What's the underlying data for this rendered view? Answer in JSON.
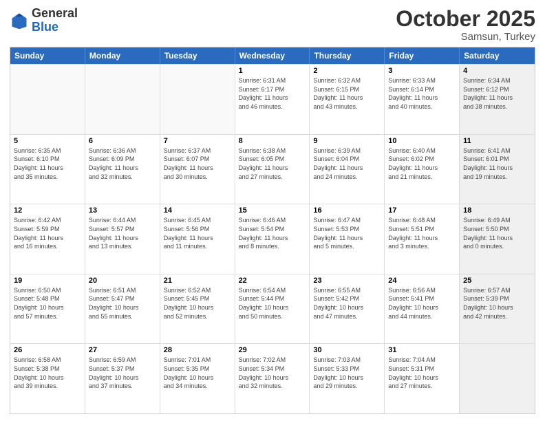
{
  "header": {
    "logo_general": "General",
    "logo_blue": "Blue",
    "month": "October 2025",
    "location": "Samsun, Turkey"
  },
  "days_of_week": [
    "Sunday",
    "Monday",
    "Tuesday",
    "Wednesday",
    "Thursday",
    "Friday",
    "Saturday"
  ],
  "weeks": [
    [
      {
        "day": "",
        "empty": true
      },
      {
        "day": "",
        "empty": true
      },
      {
        "day": "",
        "empty": true
      },
      {
        "day": "1",
        "lines": [
          "Sunrise: 6:31 AM",
          "Sunset: 6:17 PM",
          "Daylight: 11 hours",
          "and 46 minutes."
        ]
      },
      {
        "day": "2",
        "lines": [
          "Sunrise: 6:32 AM",
          "Sunset: 6:15 PM",
          "Daylight: 11 hours",
          "and 43 minutes."
        ]
      },
      {
        "day": "3",
        "lines": [
          "Sunrise: 6:33 AM",
          "Sunset: 6:14 PM",
          "Daylight: 11 hours",
          "and 40 minutes."
        ]
      },
      {
        "day": "4",
        "lines": [
          "Sunrise: 6:34 AM",
          "Sunset: 6:12 PM",
          "Daylight: 11 hours",
          "and 38 minutes."
        ],
        "shaded": true
      }
    ],
    [
      {
        "day": "5",
        "lines": [
          "Sunrise: 6:35 AM",
          "Sunset: 6:10 PM",
          "Daylight: 11 hours",
          "and 35 minutes."
        ]
      },
      {
        "day": "6",
        "lines": [
          "Sunrise: 6:36 AM",
          "Sunset: 6:09 PM",
          "Daylight: 11 hours",
          "and 32 minutes."
        ]
      },
      {
        "day": "7",
        "lines": [
          "Sunrise: 6:37 AM",
          "Sunset: 6:07 PM",
          "Daylight: 11 hours",
          "and 30 minutes."
        ]
      },
      {
        "day": "8",
        "lines": [
          "Sunrise: 6:38 AM",
          "Sunset: 6:05 PM",
          "Daylight: 11 hours",
          "and 27 minutes."
        ]
      },
      {
        "day": "9",
        "lines": [
          "Sunrise: 6:39 AM",
          "Sunset: 6:04 PM",
          "Daylight: 11 hours",
          "and 24 minutes."
        ]
      },
      {
        "day": "10",
        "lines": [
          "Sunrise: 6:40 AM",
          "Sunset: 6:02 PM",
          "Daylight: 11 hours",
          "and 21 minutes."
        ]
      },
      {
        "day": "11",
        "lines": [
          "Sunrise: 6:41 AM",
          "Sunset: 6:01 PM",
          "Daylight: 11 hours",
          "and 19 minutes."
        ],
        "shaded": true
      }
    ],
    [
      {
        "day": "12",
        "lines": [
          "Sunrise: 6:42 AM",
          "Sunset: 5:59 PM",
          "Daylight: 11 hours",
          "and 16 minutes."
        ]
      },
      {
        "day": "13",
        "lines": [
          "Sunrise: 6:44 AM",
          "Sunset: 5:57 PM",
          "Daylight: 11 hours",
          "and 13 minutes."
        ]
      },
      {
        "day": "14",
        "lines": [
          "Sunrise: 6:45 AM",
          "Sunset: 5:56 PM",
          "Daylight: 11 hours",
          "and 11 minutes."
        ]
      },
      {
        "day": "15",
        "lines": [
          "Sunrise: 6:46 AM",
          "Sunset: 5:54 PM",
          "Daylight: 11 hours",
          "and 8 minutes."
        ]
      },
      {
        "day": "16",
        "lines": [
          "Sunrise: 6:47 AM",
          "Sunset: 5:53 PM",
          "Daylight: 11 hours",
          "and 5 minutes."
        ]
      },
      {
        "day": "17",
        "lines": [
          "Sunrise: 6:48 AM",
          "Sunset: 5:51 PM",
          "Daylight: 11 hours",
          "and 3 minutes."
        ]
      },
      {
        "day": "18",
        "lines": [
          "Sunrise: 6:49 AM",
          "Sunset: 5:50 PM",
          "Daylight: 11 hours",
          "and 0 minutes."
        ],
        "shaded": true
      }
    ],
    [
      {
        "day": "19",
        "lines": [
          "Sunrise: 6:50 AM",
          "Sunset: 5:48 PM",
          "Daylight: 10 hours",
          "and 57 minutes."
        ]
      },
      {
        "day": "20",
        "lines": [
          "Sunrise: 6:51 AM",
          "Sunset: 5:47 PM",
          "Daylight: 10 hours",
          "and 55 minutes."
        ]
      },
      {
        "day": "21",
        "lines": [
          "Sunrise: 6:52 AM",
          "Sunset: 5:45 PM",
          "Daylight: 10 hours",
          "and 52 minutes."
        ]
      },
      {
        "day": "22",
        "lines": [
          "Sunrise: 6:54 AM",
          "Sunset: 5:44 PM",
          "Daylight: 10 hours",
          "and 50 minutes."
        ]
      },
      {
        "day": "23",
        "lines": [
          "Sunrise: 6:55 AM",
          "Sunset: 5:42 PM",
          "Daylight: 10 hours",
          "and 47 minutes."
        ]
      },
      {
        "day": "24",
        "lines": [
          "Sunrise: 6:56 AM",
          "Sunset: 5:41 PM",
          "Daylight: 10 hours",
          "and 44 minutes."
        ]
      },
      {
        "day": "25",
        "lines": [
          "Sunrise: 6:57 AM",
          "Sunset: 5:39 PM",
          "Daylight: 10 hours",
          "and 42 minutes."
        ],
        "shaded": true
      }
    ],
    [
      {
        "day": "26",
        "lines": [
          "Sunrise: 6:58 AM",
          "Sunset: 5:38 PM",
          "Daylight: 10 hours",
          "and 39 minutes."
        ]
      },
      {
        "day": "27",
        "lines": [
          "Sunrise: 6:59 AM",
          "Sunset: 5:37 PM",
          "Daylight: 10 hours",
          "and 37 minutes."
        ]
      },
      {
        "day": "28",
        "lines": [
          "Sunrise: 7:01 AM",
          "Sunset: 5:35 PM",
          "Daylight: 10 hours",
          "and 34 minutes."
        ]
      },
      {
        "day": "29",
        "lines": [
          "Sunrise: 7:02 AM",
          "Sunset: 5:34 PM",
          "Daylight: 10 hours",
          "and 32 minutes."
        ]
      },
      {
        "day": "30",
        "lines": [
          "Sunrise: 7:03 AM",
          "Sunset: 5:33 PM",
          "Daylight: 10 hours",
          "and 29 minutes."
        ]
      },
      {
        "day": "31",
        "lines": [
          "Sunrise: 7:04 AM",
          "Sunset: 5:31 PM",
          "Daylight: 10 hours",
          "and 27 minutes."
        ]
      },
      {
        "day": "",
        "empty": true,
        "shaded": true
      }
    ]
  ]
}
